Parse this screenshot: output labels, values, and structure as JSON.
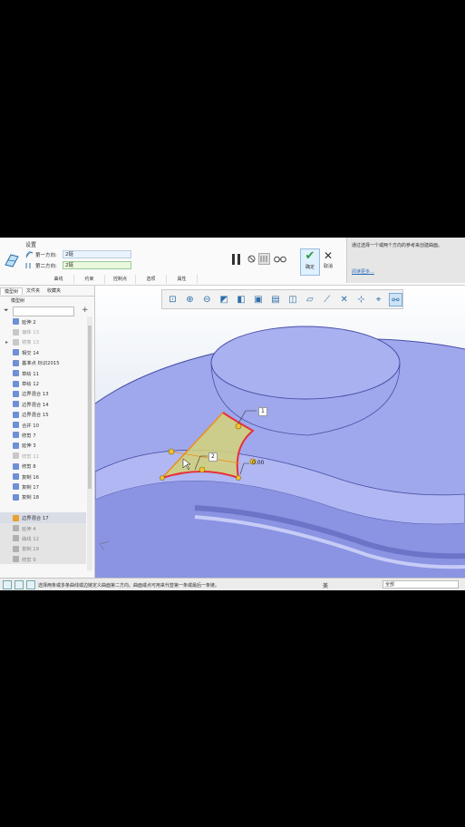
{
  "dashboard": {
    "settings_label": "设置",
    "first_direction_label": "第一方向:",
    "first_direction_value": "2链",
    "second_direction_label": "第二方向:",
    "second_direction_value": "2链",
    "ok_label": "确定",
    "cancel_label": "取消",
    "tabs": [
      "曲线",
      "约束",
      "控制点",
      "选项",
      "属性"
    ],
    "help_text": "通过选择一个或两个方向的参考来创建曲面。",
    "help_more": "阅读更多..."
  },
  "left_panel": {
    "tabs": [
      "模型树",
      "文件夹",
      "收藏夹"
    ],
    "title": "模型树",
    "items": [
      {
        "label": "延伸 2",
        "state": "normal",
        "expandable": false
      },
      {
        "label": "偏移 13",
        "state": "grey",
        "expandable": false
      },
      {
        "label": "镜像 13",
        "state": "grey",
        "expandable": true
      },
      {
        "label": "相交 14",
        "state": "normal",
        "expandable": false
      },
      {
        "label": "基准点 标识2015",
        "state": "normal",
        "expandable": false
      },
      {
        "label": "草绘 11",
        "state": "normal",
        "expandable": false
      },
      {
        "label": "草绘 12",
        "state": "normal",
        "expandable": false
      },
      {
        "label": "边界混合 13",
        "state": "normal",
        "expandable": false
      },
      {
        "label": "边界混合 14",
        "state": "normal",
        "expandable": false
      },
      {
        "label": "边界混合 15",
        "state": "normal",
        "expandable": false
      },
      {
        "label": "合并 10",
        "state": "normal",
        "expandable": false
      },
      {
        "label": "修剪 7",
        "state": "normal",
        "expandable": false
      },
      {
        "label": "延伸 3",
        "state": "normal",
        "expandable": false
      },
      {
        "label": "修剪 11",
        "state": "grey",
        "expandable": false
      },
      {
        "label": "修剪 8",
        "state": "normal",
        "expandable": false
      },
      {
        "label": "复制 16",
        "state": "normal",
        "expandable": false
      },
      {
        "label": "复制 17",
        "state": "normal",
        "expandable": false
      },
      {
        "label": "复制 18",
        "state": "normal",
        "expandable": false
      },
      {
        "label": "",
        "state": "blank",
        "expandable": false
      },
      {
        "label": "边界混合 17",
        "state": "current",
        "expandable": false
      },
      {
        "label": "延伸 4",
        "state": "after",
        "expandable": false
      },
      {
        "label": "曲线 12",
        "state": "after",
        "expandable": false
      },
      {
        "label": "复制 19",
        "state": "after",
        "expandable": false
      },
      {
        "label": "修剪 9",
        "state": "after",
        "expandable": false
      }
    ]
  },
  "viewport": {
    "callout_1": "1",
    "callout_2": "2",
    "callout_value": "0.00"
  },
  "status": {
    "message": "选择两条或多条曲线或边链定义曲面第二方向。曲面或点可用来代替第一条或最后一条链。",
    "unit": "美",
    "filter": "全部"
  },
  "colors": {
    "surface": "#9fa8ec",
    "surface_dark": "#7c86d6",
    "preview_fill": "#d4d27a",
    "chain_red": "#e8303a",
    "handle_yellow": "#f1c232",
    "accent_blue": "#2a6ebb"
  }
}
